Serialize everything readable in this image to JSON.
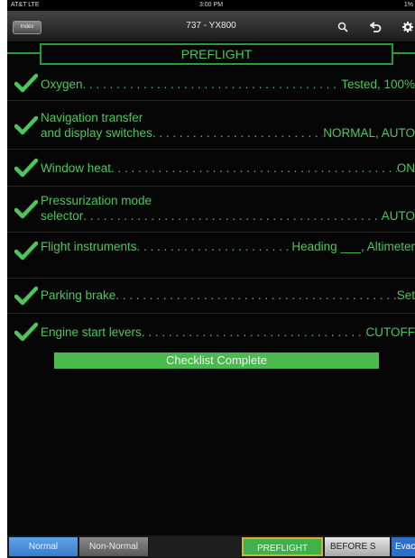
{
  "status_bar": {
    "carrier": "AT&T LTE",
    "time": "3:00 PM",
    "battery": "1%"
  },
  "nav": {
    "index_label": "Index",
    "title": "737 - YX800",
    "icons": [
      "search-icon",
      "back-icon",
      "gear-icon"
    ]
  },
  "section_title": "PREFLIGHT",
  "items": [
    {
      "line1": "Oxygen",
      "line2": "",
      "value": "Tested, 100%"
    },
    {
      "line1": "Navigation transfer",
      "line2": "and display switches",
      "value": "NORMAL, AUTO"
    },
    {
      "line1": "Window heat",
      "line2": "",
      "value": "ON"
    },
    {
      "line1": "Pressurization mode",
      "line2": "selector",
      "value": "AUTO"
    },
    {
      "line1": "Flight instruments",
      "line2": "",
      "value": "Heading ___, Altimeter"
    },
    {
      "line1": "Parking brake",
      "line2": "",
      "value": "Set"
    },
    {
      "line1": "Engine start levers",
      "line2": "",
      "value": "CUTOFF"
    }
  ],
  "complete_label": "Checklist Complete",
  "tabs": [
    {
      "label": "Normal"
    },
    {
      "label": "Non-Normal"
    },
    {
      "label": ""
    },
    {
      "label": "PREFLIGHT"
    },
    {
      "label": "BEFORE S"
    },
    {
      "label": "Evac"
    }
  ],
  "colors": {
    "accent_green": "#4cc65a",
    "complete_green": "#4aba4e",
    "tab_blue": "#4a8fd8",
    "background": "#050505"
  }
}
